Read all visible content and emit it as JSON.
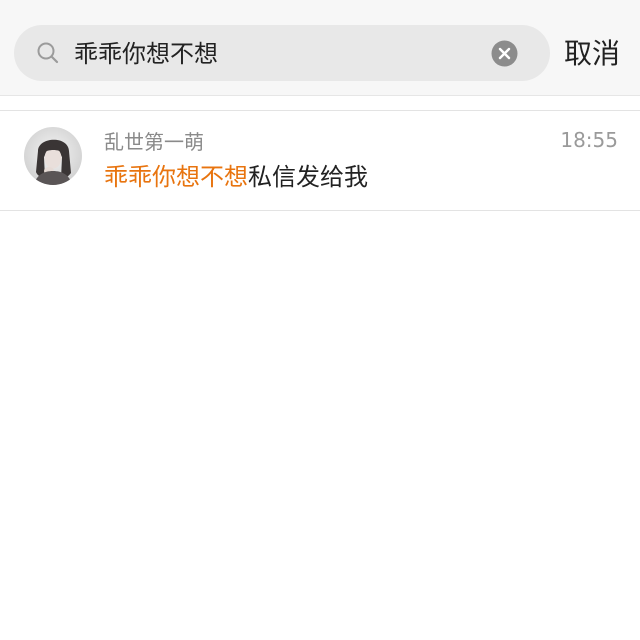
{
  "colors": {
    "highlight": "#e8740f",
    "search_bar_bg": "#e8e8e8",
    "top_area_bg": "#f7f7f7"
  },
  "search": {
    "query": "乖乖你想不想",
    "search_icon": "search-icon",
    "clear_icon": "clear-icon"
  },
  "header": {
    "cancel_label": "取消"
  },
  "results": [
    {
      "sender": "乱世第一萌",
      "time": "18:55",
      "message_highlight": "乖乖你想不想",
      "message_rest": "私信发给我",
      "avatar": "avatar"
    }
  ]
}
